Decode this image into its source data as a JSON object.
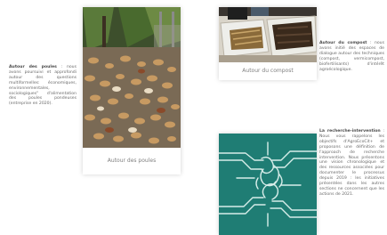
{
  "poules": {
    "card_caption": "Autour des poules",
    "desc_title": "Autour des poules",
    "desc_text": ": nous avons poursuivi et approfondi autour des questions multiformelles: économiques, environnementales, sociologiques\" d'alimentation des poules pondeuses (entreprise en 2020)."
  },
  "compost": {
    "card_caption": "Autour du compost",
    "desc_title": "Autour du compost",
    "desc_text": ": nous avons initié des espaces de dialogue autour des techniques (compost, vermicompost, biofertilisants) d'intérêt agroécologique."
  },
  "recherche": {
    "desc_title": "La recherche-intervention",
    "desc_text": ": Nous vous rappelons les objectifs d'AgroEcoCit+ et proposons une définition de l'approach de recherche intervention. Nous présentons une vision chronologique et des ressources associées pour documenter le processus depuis 2019 : les initiatives présentées dans les autres sections ne concernent que les actions de 2021."
  },
  "colors": {
    "teal": "#1f7d74",
    "teal_light": "#d7ede9"
  }
}
